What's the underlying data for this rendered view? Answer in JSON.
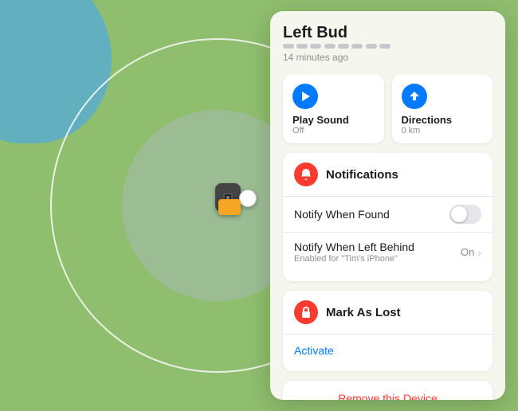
{
  "map": {
    "bg_color": "#8fbe6e"
  },
  "panel": {
    "title": "Left Bud",
    "time_ago": "14 minutes ago",
    "actions": [
      {
        "id": "play-sound",
        "label": "Play Sound",
        "sublabel": "Off",
        "icon": "play"
      },
      {
        "id": "directions",
        "label": "Directions",
        "sublabel": "0 km",
        "icon": "arrow"
      }
    ],
    "notifications": {
      "title": "Notifications",
      "notify_found_label": "Notify When Found",
      "notify_found_toggle": false,
      "notify_left_label": "Notify When Left Behind",
      "notify_left_value": "On",
      "notify_left_sub": "Enabled for \"Tim's iPhone\""
    },
    "lost": {
      "title": "Mark As Lost",
      "activate_label": "Activate"
    },
    "remove": {
      "label": "Remove this Device"
    }
  }
}
